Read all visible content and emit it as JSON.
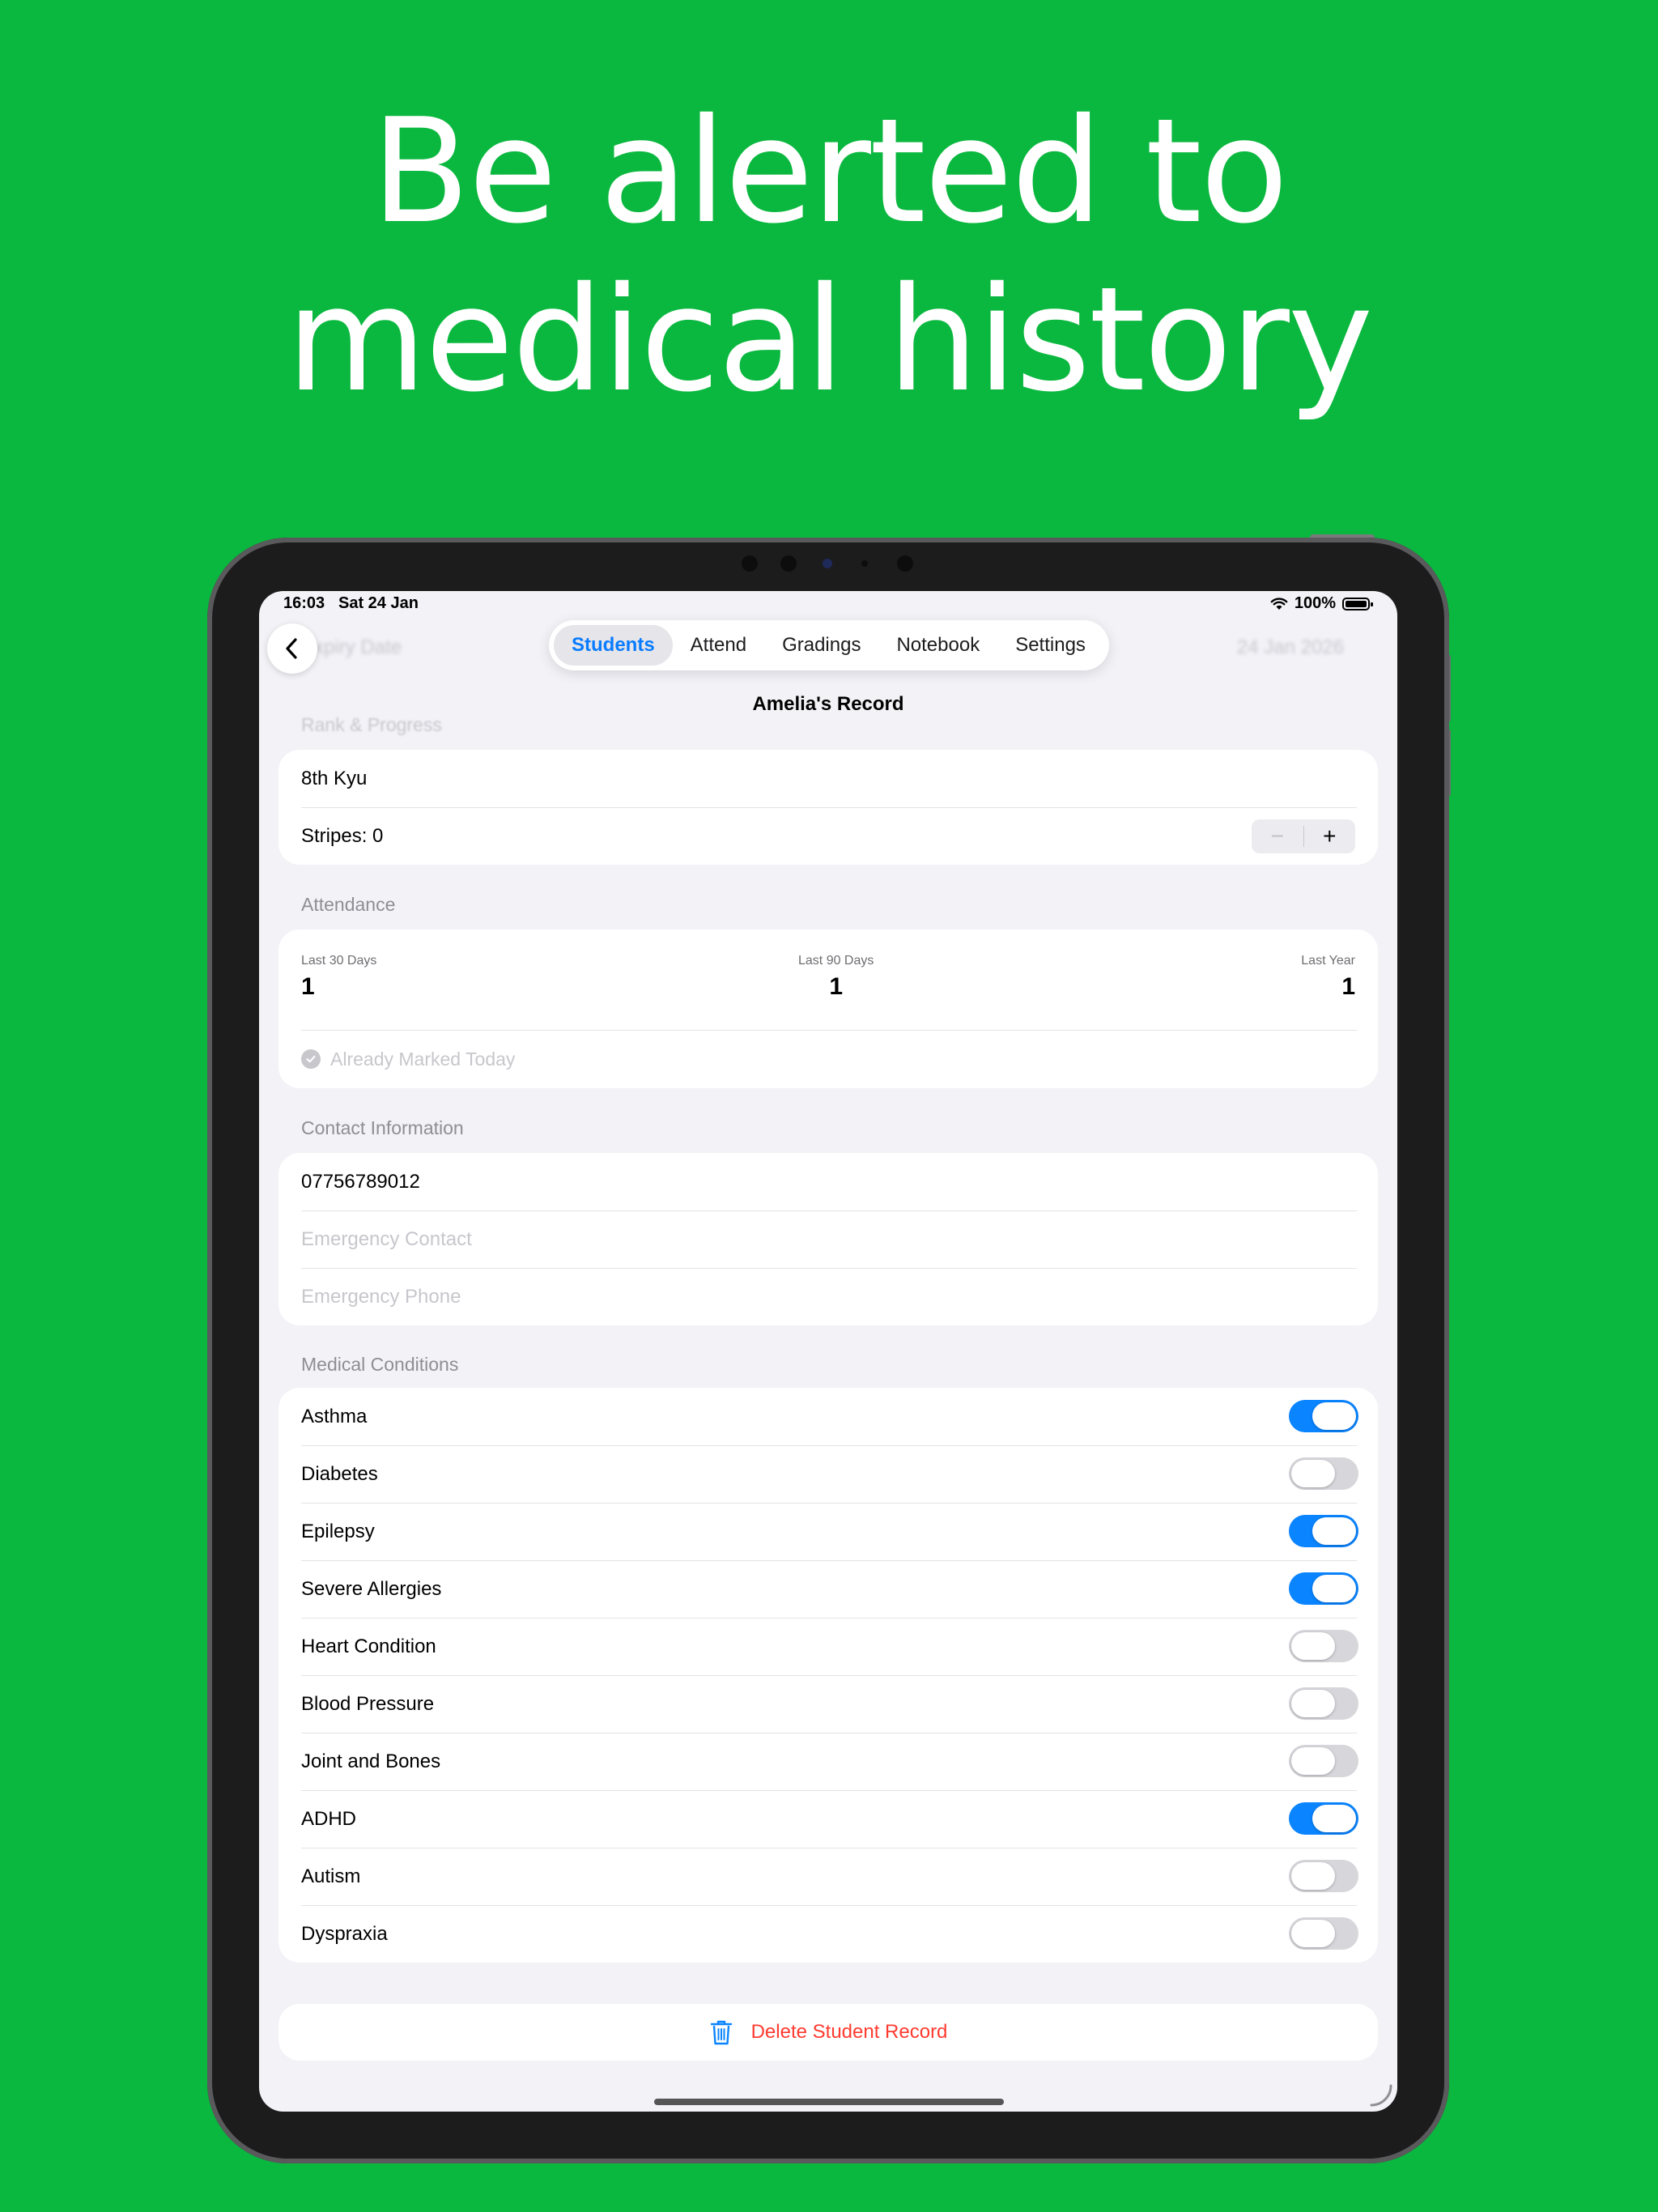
{
  "headline": {
    "line1": "Be alerted to",
    "line2": "medical history"
  },
  "status_bar": {
    "time": "16:03",
    "date": "Sat 24 Jan",
    "battery": "100%",
    "icons": [
      "wifi-icon",
      "battery-icon"
    ]
  },
  "background_ghost": {
    "left": "Expiry Date",
    "right": "24 Jan 2026"
  },
  "nav": {
    "back_icon": "chevron-left-icon",
    "tabs": [
      {
        "label": "Students",
        "active": true
      },
      {
        "label": "Attend",
        "active": false
      },
      {
        "label": "Gradings",
        "active": false
      },
      {
        "label": "Notebook",
        "active": false
      },
      {
        "label": "Settings",
        "active": false
      }
    ],
    "title": "Amelia's Record"
  },
  "rank": {
    "section_label": "Rank & Progress",
    "rank_value": "8th Kyu",
    "stripes_label": "Stripes: 0",
    "stepper": {
      "minus": "−",
      "plus": "+"
    }
  },
  "attendance": {
    "section_label": "Attendance",
    "last30_label": "Last 30 Days",
    "last30_value": "1",
    "last90_label": "Last 90 Days",
    "last90_value": "1",
    "lastyear_label": "Last Year",
    "lastyear_value": "1",
    "marked_label": "Already Marked Today"
  },
  "contact": {
    "section_label": "Contact Information",
    "phone": "07756789012",
    "emergency_contact_placeholder": "Emergency Contact",
    "emergency_phone_placeholder": "Emergency Phone"
  },
  "medical": {
    "section_label": "Medical Conditions",
    "conditions": [
      {
        "label": "Asthma",
        "on": true
      },
      {
        "label": "Diabetes",
        "on": false
      },
      {
        "label": "Epilepsy",
        "on": true
      },
      {
        "label": "Severe Allergies",
        "on": true
      },
      {
        "label": "Heart Condition",
        "on": false
      },
      {
        "label": "Blood Pressure",
        "on": false
      },
      {
        "label": "Joint and Bones",
        "on": false
      },
      {
        "label": "ADHD",
        "on": true
      },
      {
        "label": "Autism",
        "on": false
      },
      {
        "label": "Dyspraxia",
        "on": false
      }
    ]
  },
  "delete": {
    "label": "Delete Student Record",
    "icon": "trash-icon"
  },
  "colors": {
    "background": "#0bb83f",
    "accent": "#0a84ff",
    "destructive": "#ff3b30"
  }
}
